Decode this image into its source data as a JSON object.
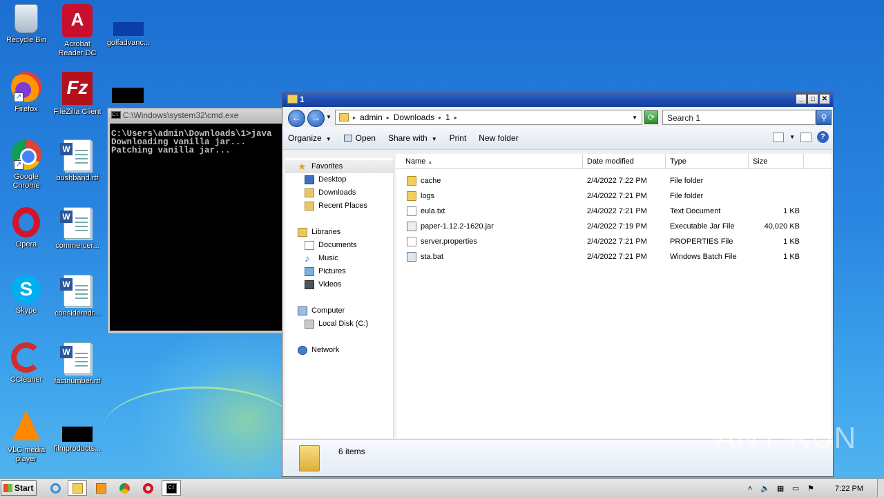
{
  "desktop": {
    "icons": [
      {
        "label": "Recycle Bin",
        "icon": "recycle-bin-icon"
      },
      {
        "label": "Acrobat Reader DC",
        "icon": "acrobat-icon"
      },
      {
        "label": "golfadvanc...",
        "icon": "file-icon"
      },
      {
        "label": "Firefox",
        "icon": "firefox-icon"
      },
      {
        "label": "FileZilla Client",
        "icon": "filezilla-icon"
      },
      {
        "label": "Google Chrome",
        "icon": "chrome-icon"
      },
      {
        "label": "bushband.rtf",
        "icon": "word-document-icon"
      },
      {
        "label": "Opera",
        "icon": "opera-icon"
      },
      {
        "label": "commercer...",
        "icon": "word-document-icon"
      },
      {
        "label": "Skype",
        "icon": "skype-icon"
      },
      {
        "label": "consideredr...",
        "icon": "word-document-icon"
      },
      {
        "label": "CCleaner",
        "icon": "ccleaner-icon"
      },
      {
        "label": "factnumber.rtf",
        "icon": "word-document-icon"
      },
      {
        "label": "VLC media player",
        "icon": "vlc-icon"
      },
      {
        "label": "filmproducts...",
        "icon": "file-icon"
      }
    ],
    "watermark": "ANY RUN"
  },
  "cmd": {
    "title": "C:\\Windows\\system32\\cmd.exe",
    "lines": "C:\\Users\\admin\\Downloads\\1>java\nDownloading vanilla jar...\nPatching vanilla jar..."
  },
  "explorer": {
    "title": "1",
    "breadcrumb": [
      "admin",
      "Downloads",
      "1"
    ],
    "search_placeholder": "Search 1",
    "toolbar": {
      "organize": "Organize",
      "open": "Open",
      "share_with": "Share with",
      "print": "Print",
      "new_folder": "New folder"
    },
    "nav": {
      "favorites": "Favorites",
      "desktop": "Desktop",
      "downloads": "Downloads",
      "recent_places": "Recent Places",
      "libraries": "Libraries",
      "documents": "Documents",
      "music": "Music",
      "pictures": "Pictures",
      "videos": "Videos",
      "computer": "Computer",
      "local_disk": "Local Disk (C:)",
      "network": "Network"
    },
    "columns": {
      "name": "Name",
      "date": "Date modified",
      "type": "Type",
      "size": "Size"
    },
    "files": [
      {
        "name": "cache",
        "date": "2/4/2022 7:22 PM",
        "type": "File folder",
        "size": "",
        "icon": "folder-icon"
      },
      {
        "name": "logs",
        "date": "2/4/2022 7:21 PM",
        "type": "File folder",
        "size": "",
        "icon": "folder-icon"
      },
      {
        "name": "eula.txt",
        "date": "2/4/2022 7:21 PM",
        "type": "Text Document",
        "size": "1 KB",
        "icon": "text-file-icon"
      },
      {
        "name": "paper-1.12.2-1620.jar",
        "date": "2/4/2022 7:19 PM",
        "type": "Executable Jar File",
        "size": "40,020 KB",
        "icon": "jar-file-icon"
      },
      {
        "name": "server.properties",
        "date": "2/4/2022 7:21 PM",
        "type": "PROPERTIES File",
        "size": "1 KB",
        "icon": "file-icon"
      },
      {
        "name": "sta.bat",
        "date": "2/4/2022 7:21 PM",
        "type": "Windows Batch File",
        "size": "1 KB",
        "icon": "batch-file-icon"
      }
    ],
    "status": "6 items"
  },
  "taskbar": {
    "start": "Start",
    "clock": "7:22 PM"
  }
}
